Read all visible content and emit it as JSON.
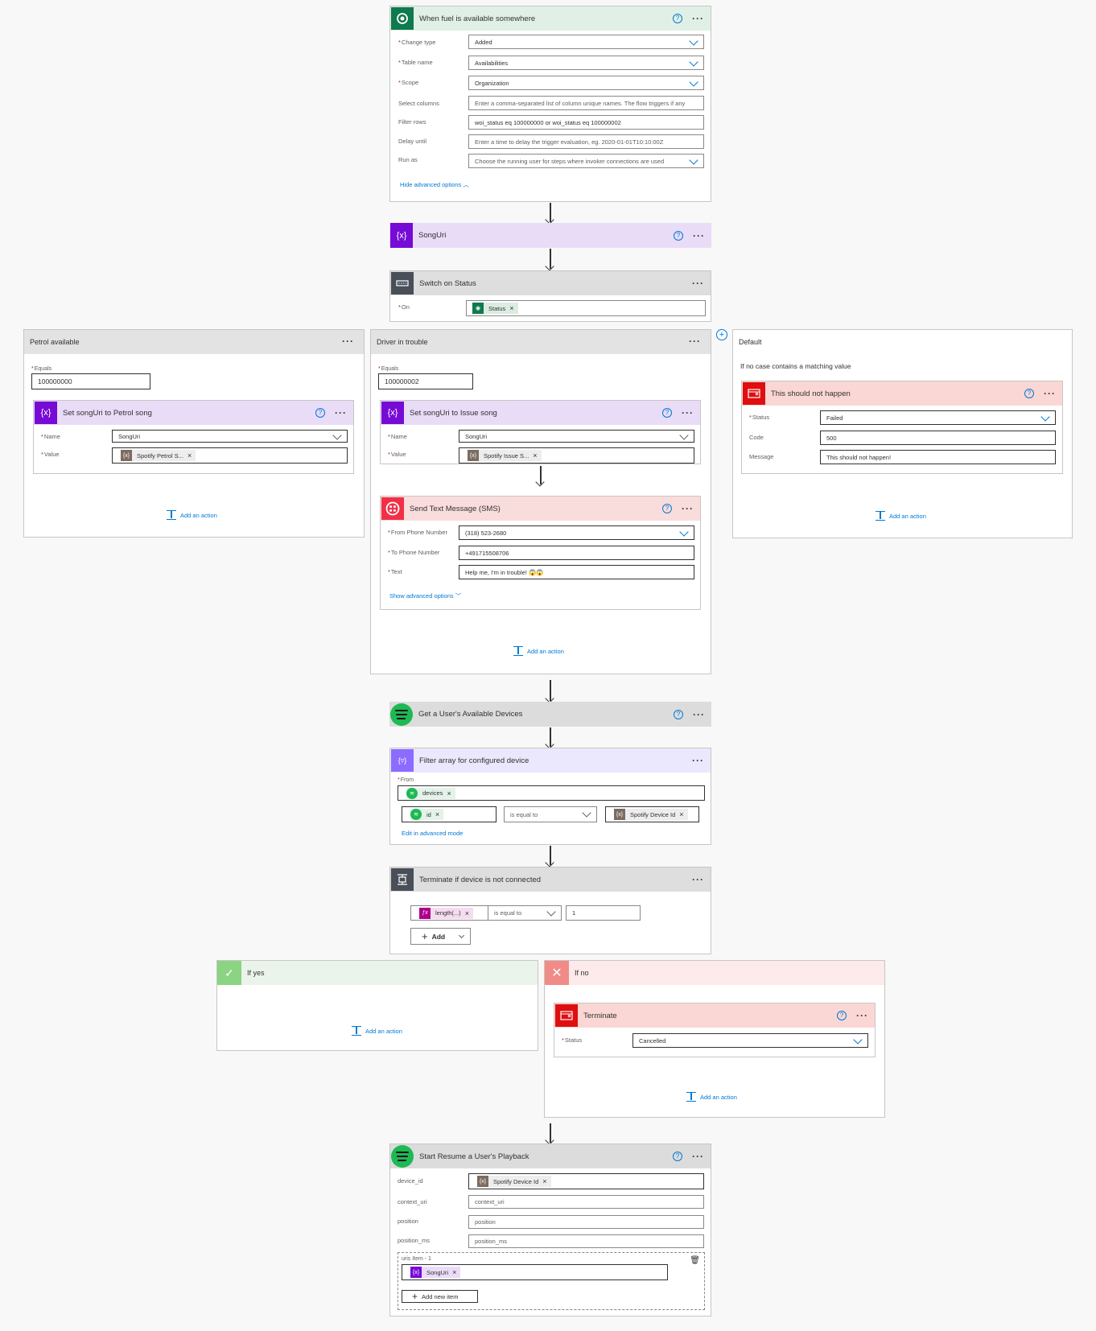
{
  "trigger": {
    "title": "When fuel is available somewhere",
    "fields": [
      {
        "label": "Change type",
        "value": "Added",
        "required": true
      },
      {
        "label": "Table name",
        "value": "Availabilities",
        "required": true
      },
      {
        "label": "Scope",
        "value": "Organization",
        "required": true
      },
      {
        "label": "Select columns",
        "placeholder": "Enter a comma-separated list of column unique names. The flow triggers if any"
      },
      {
        "label": "Filter rows",
        "value": "woi_status eq 100000000 or woi_status eq 100000002"
      },
      {
        "label": "Delay until",
        "placeholder": "Enter a time to delay the trigger evaluation, eg. 2020-01-01T10:10:00Z"
      },
      {
        "label": "Run as",
        "placeholder": "Choose the running user for steps where invoker connections are used"
      }
    ],
    "hide_advanced": "Hide advanced options"
  },
  "songuri": {
    "title": "SongUri"
  },
  "switch": {
    "title": "Switch on Status",
    "on_label": "On",
    "on_token": "Status"
  },
  "case_petrol": {
    "title": "Petrol available",
    "equals_label": "Equals",
    "equals_value": "100000000",
    "action_title": "Set songUri to Petrol song",
    "name_label": "Name",
    "name_value": "SongUri",
    "value_label": "Value",
    "value_token": "Spotify Petrol S...",
    "add_action": "Add an action"
  },
  "case_driver": {
    "title": "Driver in trouble",
    "equals_label": "Equals",
    "equals_value": "100000002",
    "action_title": "Set songUri to Issue song",
    "name_label": "Name",
    "name_value": "SongUri",
    "value_label": "Value",
    "value_token": "Spotify Issue S...",
    "sms_title": "Send Text Message (SMS)",
    "from_label": "From Phone Number",
    "from_value": "(318) 523-2680",
    "to_label": "To Phone Number",
    "to_value": "+491715508706",
    "text_label": "Text",
    "text_value": "Help me, I'm in trouble! 😱😱",
    "show_advanced": "Show advanced options",
    "add_action": "Add an action"
  },
  "case_default": {
    "title": "Default",
    "note": "If no case contains a matching value",
    "action_title": "This should not happen",
    "status_label": "Status",
    "status_value": "Failed",
    "code_label": "Code",
    "code_value": "500",
    "message_label": "Message",
    "message_value": "This should not happen!",
    "add_action": "Add an action"
  },
  "devices": {
    "title": "Get a User's Available Devices"
  },
  "filter": {
    "title": "Filter array for configured device",
    "from_label": "From",
    "from_token": "devices",
    "left_token": "id",
    "operator": "is equal to",
    "right_token": "Spotify Device Id",
    "edit_advanced": "Edit in advanced mode"
  },
  "condition": {
    "title": "Terminate if device is not connected",
    "left_token": "length(...)",
    "operator": "is equal to",
    "right_value": "1",
    "add_label": "Add"
  },
  "if_yes": {
    "title": "If yes",
    "add_action": "Add an action"
  },
  "if_no": {
    "title": "If no",
    "action_title": "Terminate",
    "status_label": "Status",
    "status_value": "Cancelled",
    "add_action": "Add an action"
  },
  "playback": {
    "title": "Start Resume a User's Playback",
    "device_label": "device_id",
    "device_token": "Spotify Device Id",
    "context_label": "context_uri",
    "context_placeholder": "context_uri",
    "position_label": "position",
    "position_placeholder": "position",
    "position_ms_label": "position_ms",
    "position_ms_placeholder": "position_ms",
    "uris_label": "uris Item - 1",
    "uris_token": "SongUri",
    "add_new_item": "Add new item"
  },
  "colors": {
    "dataverse": "#0e7a4e",
    "variable": "#770bd6",
    "control": "#484f58",
    "twilio": "#f22f46",
    "terminate": "#e00e0e",
    "spotify": "#1db954",
    "filter": "#8c6cff",
    "link": "#0078d4"
  }
}
